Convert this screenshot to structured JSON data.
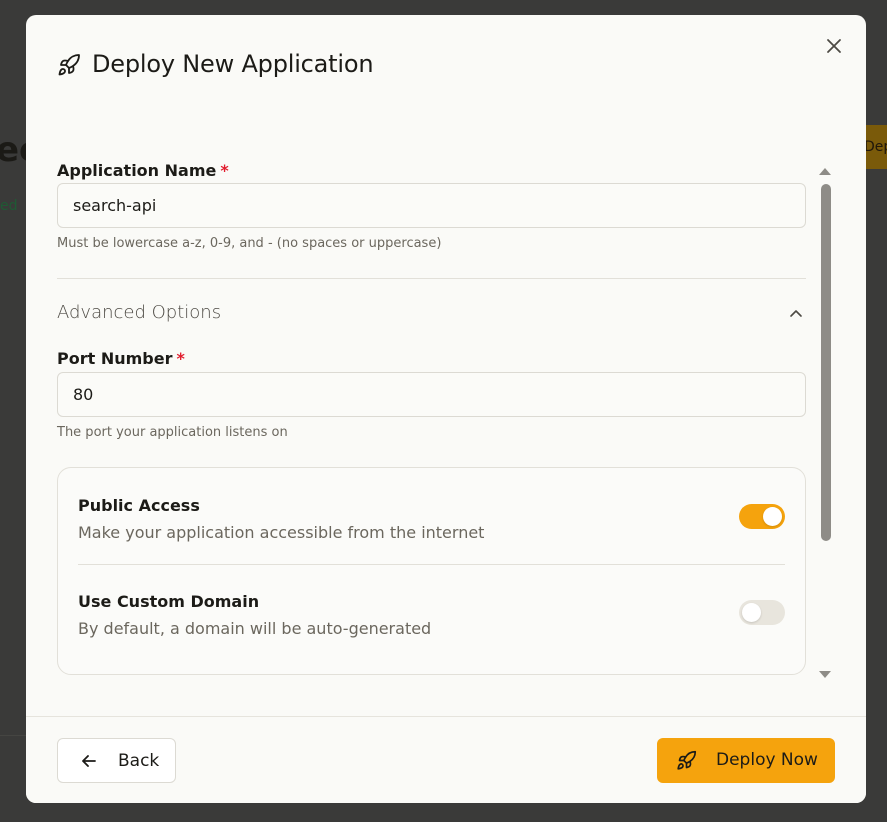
{
  "backdrop": {
    "title_fragment": "ec",
    "status_fragment": "ed",
    "button_fragment": "Dep"
  },
  "modal": {
    "title": "Deploy New Application",
    "header_icon": "rocket-icon",
    "close_icon": "close-icon"
  },
  "form": {
    "app_name": {
      "label": "Application Name",
      "required_mark": "*",
      "value": "search-api",
      "hint": "Must be lowercase a-z, 0-9, and - (no spaces or uppercase)"
    },
    "advanced": {
      "label": "Advanced Options",
      "expanded": true,
      "chevron_icon": "chevron-up-icon"
    },
    "port": {
      "label": "Port Number",
      "required_mark": "*",
      "value": "80",
      "hint": "The port your application listens on"
    },
    "options": [
      {
        "title": "Public Access",
        "description": "Make your application accessible from the internet",
        "enabled": true
      },
      {
        "title": "Use Custom Domain",
        "description": "By default, a domain will be auto-generated",
        "enabled": false
      }
    ]
  },
  "footer": {
    "back_label": "Back",
    "back_icon": "arrow-left-icon",
    "deploy_label": "Deploy Now",
    "deploy_icon": "rocket-icon"
  },
  "colors": {
    "accent": "#f5a30d",
    "required": "#e11d2e",
    "backdrop": "#3a3a39",
    "modal_bg": "#fafaf7"
  }
}
